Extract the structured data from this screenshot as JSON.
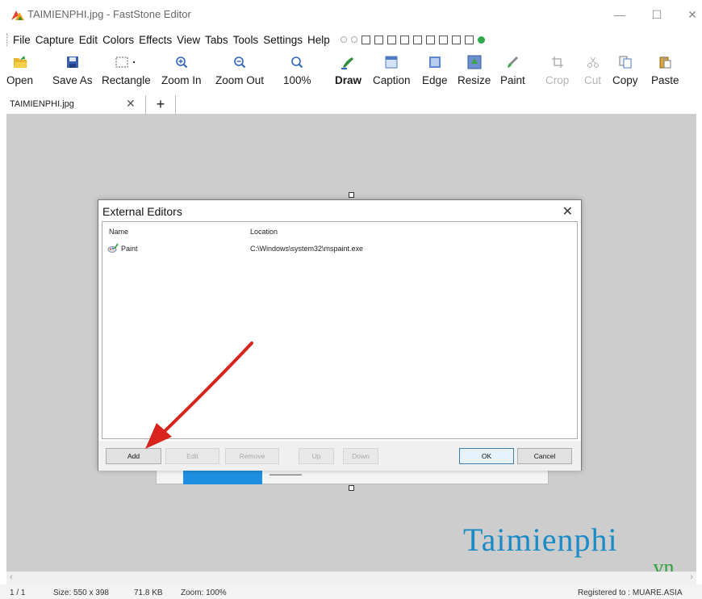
{
  "window": {
    "title": "TAIMIENPHI.jpg - FastStone Editor",
    "minimize_glyph": "—",
    "maximize_glyph": "☐",
    "close_glyph": "✕"
  },
  "menu": {
    "items": [
      "File",
      "Capture",
      "Edit",
      "Colors",
      "Effects",
      "View",
      "Tabs",
      "Tools",
      "Settings",
      "Help"
    ]
  },
  "toolbar": {
    "open": "Open",
    "save_as": "Save As",
    "rectangle": "Rectangle",
    "zoom_in": "Zoom In",
    "zoom_out": "Zoom Out",
    "zoom_level": "100%",
    "draw": "Draw",
    "caption": "Caption",
    "edge": "Edge",
    "resize": "Resize",
    "paint": "Paint",
    "crop": "Crop",
    "cut": "Cut",
    "copy": "Copy",
    "paste": "Paste"
  },
  "tabs": {
    "active": "TAIMIENPHI.jpg",
    "close_glyph": "✕",
    "add_glyph": "+"
  },
  "dialog": {
    "title": "External Editors",
    "close_glyph": "✕",
    "columns": {
      "name": "Name",
      "location": "Location"
    },
    "rows": [
      {
        "name": "Paint",
        "location": "C:\\Windows\\system32\\mspaint.exe"
      }
    ],
    "buttons": {
      "add": "Add",
      "edit": "Edit",
      "remove": "Remove",
      "up": "Up",
      "down": "Down",
      "ok": "OK",
      "cancel": "Cancel"
    }
  },
  "watermark": {
    "brand": "Taimienphi",
    "suffix": ".vn"
  },
  "status": {
    "page": "1 / 1",
    "size": "Size: 550 x 398",
    "file_size": "71.8 KB",
    "zoom": "Zoom: 100%",
    "registered": "Registered to : MUARE.ASIA"
  },
  "colors": {
    "canvas_bg": "#cdcdcd",
    "watermark_blue": "#1a8bc6",
    "watermark_green": "#2ea13a",
    "arrow_red": "#d9231d"
  }
}
